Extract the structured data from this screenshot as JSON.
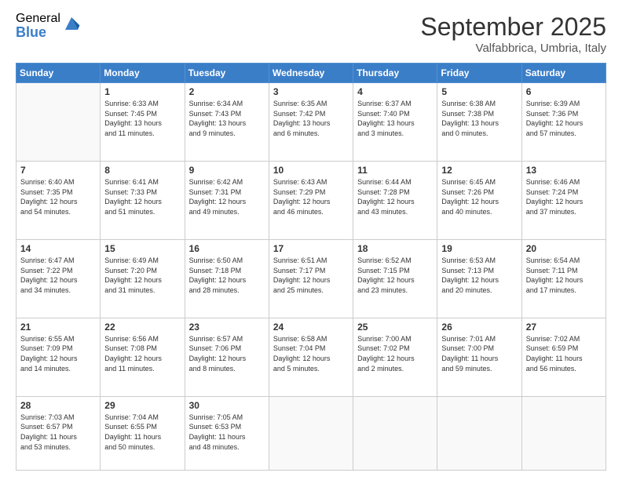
{
  "logo": {
    "general": "General",
    "blue": "Blue"
  },
  "title": {
    "month": "September 2025",
    "location": "Valfabbrica, Umbria, Italy"
  },
  "days_header": [
    "Sunday",
    "Monday",
    "Tuesday",
    "Wednesday",
    "Thursday",
    "Friday",
    "Saturday"
  ],
  "weeks": [
    [
      {
        "day": "",
        "info": ""
      },
      {
        "day": "1",
        "info": "Sunrise: 6:33 AM\nSunset: 7:45 PM\nDaylight: 13 hours\nand 11 minutes."
      },
      {
        "day": "2",
        "info": "Sunrise: 6:34 AM\nSunset: 7:43 PM\nDaylight: 13 hours\nand 9 minutes."
      },
      {
        "day": "3",
        "info": "Sunrise: 6:35 AM\nSunset: 7:42 PM\nDaylight: 13 hours\nand 6 minutes."
      },
      {
        "day": "4",
        "info": "Sunrise: 6:37 AM\nSunset: 7:40 PM\nDaylight: 13 hours\nand 3 minutes."
      },
      {
        "day": "5",
        "info": "Sunrise: 6:38 AM\nSunset: 7:38 PM\nDaylight: 13 hours\nand 0 minutes."
      },
      {
        "day": "6",
        "info": "Sunrise: 6:39 AM\nSunset: 7:36 PM\nDaylight: 12 hours\nand 57 minutes."
      }
    ],
    [
      {
        "day": "7",
        "info": "Sunrise: 6:40 AM\nSunset: 7:35 PM\nDaylight: 12 hours\nand 54 minutes."
      },
      {
        "day": "8",
        "info": "Sunrise: 6:41 AM\nSunset: 7:33 PM\nDaylight: 12 hours\nand 51 minutes."
      },
      {
        "day": "9",
        "info": "Sunrise: 6:42 AM\nSunset: 7:31 PM\nDaylight: 12 hours\nand 49 minutes."
      },
      {
        "day": "10",
        "info": "Sunrise: 6:43 AM\nSunset: 7:29 PM\nDaylight: 12 hours\nand 46 minutes."
      },
      {
        "day": "11",
        "info": "Sunrise: 6:44 AM\nSunset: 7:28 PM\nDaylight: 12 hours\nand 43 minutes."
      },
      {
        "day": "12",
        "info": "Sunrise: 6:45 AM\nSunset: 7:26 PM\nDaylight: 12 hours\nand 40 minutes."
      },
      {
        "day": "13",
        "info": "Sunrise: 6:46 AM\nSunset: 7:24 PM\nDaylight: 12 hours\nand 37 minutes."
      }
    ],
    [
      {
        "day": "14",
        "info": "Sunrise: 6:47 AM\nSunset: 7:22 PM\nDaylight: 12 hours\nand 34 minutes."
      },
      {
        "day": "15",
        "info": "Sunrise: 6:49 AM\nSunset: 7:20 PM\nDaylight: 12 hours\nand 31 minutes."
      },
      {
        "day": "16",
        "info": "Sunrise: 6:50 AM\nSunset: 7:18 PM\nDaylight: 12 hours\nand 28 minutes."
      },
      {
        "day": "17",
        "info": "Sunrise: 6:51 AM\nSunset: 7:17 PM\nDaylight: 12 hours\nand 25 minutes."
      },
      {
        "day": "18",
        "info": "Sunrise: 6:52 AM\nSunset: 7:15 PM\nDaylight: 12 hours\nand 23 minutes."
      },
      {
        "day": "19",
        "info": "Sunrise: 6:53 AM\nSunset: 7:13 PM\nDaylight: 12 hours\nand 20 minutes."
      },
      {
        "day": "20",
        "info": "Sunrise: 6:54 AM\nSunset: 7:11 PM\nDaylight: 12 hours\nand 17 minutes."
      }
    ],
    [
      {
        "day": "21",
        "info": "Sunrise: 6:55 AM\nSunset: 7:09 PM\nDaylight: 12 hours\nand 14 minutes."
      },
      {
        "day": "22",
        "info": "Sunrise: 6:56 AM\nSunset: 7:08 PM\nDaylight: 12 hours\nand 11 minutes."
      },
      {
        "day": "23",
        "info": "Sunrise: 6:57 AM\nSunset: 7:06 PM\nDaylight: 12 hours\nand 8 minutes."
      },
      {
        "day": "24",
        "info": "Sunrise: 6:58 AM\nSunset: 7:04 PM\nDaylight: 12 hours\nand 5 minutes."
      },
      {
        "day": "25",
        "info": "Sunrise: 7:00 AM\nSunset: 7:02 PM\nDaylight: 12 hours\nand 2 minutes."
      },
      {
        "day": "26",
        "info": "Sunrise: 7:01 AM\nSunset: 7:00 PM\nDaylight: 11 hours\nand 59 minutes."
      },
      {
        "day": "27",
        "info": "Sunrise: 7:02 AM\nSunset: 6:59 PM\nDaylight: 11 hours\nand 56 minutes."
      }
    ],
    [
      {
        "day": "28",
        "info": "Sunrise: 7:03 AM\nSunset: 6:57 PM\nDaylight: 11 hours\nand 53 minutes."
      },
      {
        "day": "29",
        "info": "Sunrise: 7:04 AM\nSunset: 6:55 PM\nDaylight: 11 hours\nand 50 minutes."
      },
      {
        "day": "30",
        "info": "Sunrise: 7:05 AM\nSunset: 6:53 PM\nDaylight: 11 hours\nand 48 minutes."
      },
      {
        "day": "",
        "info": ""
      },
      {
        "day": "",
        "info": ""
      },
      {
        "day": "",
        "info": ""
      },
      {
        "day": "",
        "info": ""
      }
    ]
  ]
}
